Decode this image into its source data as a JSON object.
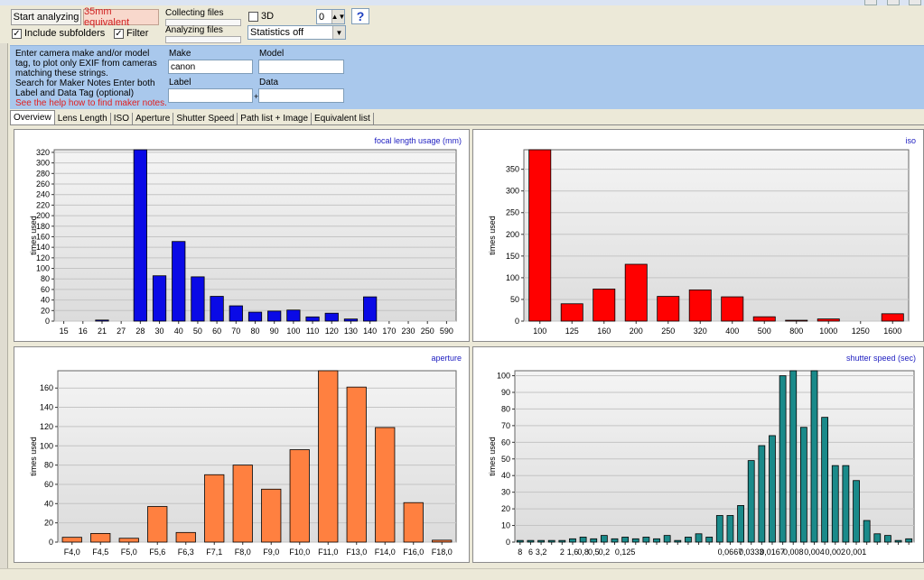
{
  "toolbar": {
    "start_label": "Start analyzing",
    "equiv_label": "35mm equivalent",
    "include_subfolders_label": "Include subfolders",
    "include_subfolders_checked": true,
    "filter_label": "Filter",
    "filter_checked": true,
    "collecting_label": "Collecting files",
    "analyzing_label": "Analyzing files",
    "threed_label": "3D",
    "threed_checked": false,
    "spinner_value": "0",
    "statistics_value": "Statistics off",
    "help_label": "?"
  },
  "filter_panel": {
    "make_instructions": "Enter camera make and/or model tag, to plot only EXIF from cameras matching these strings.",
    "makernote_instructions": "Search for Maker Notes Enter both Label and Data Tag (optional)",
    "help_link": "See the help how to find maker notes.",
    "make_label": "Make",
    "make_value": "canon",
    "model_label": "Model",
    "model_value": "",
    "label_label": "Label",
    "label_value": "",
    "data_label": "Data",
    "data_value": "",
    "plus": "+"
  },
  "tabs": [
    {
      "label": "Overview",
      "active": true
    },
    {
      "label": "Lens Length",
      "active": false
    },
    {
      "label": "ISO",
      "active": false
    },
    {
      "label": "Aperture",
      "active": false
    },
    {
      "label": "Shutter Speed",
      "active": false
    },
    {
      "label": "Path list + Image",
      "active": false
    },
    {
      "label": "Equivalent list",
      "active": false
    }
  ],
  "colors": {
    "focal": "#0a0ae6",
    "iso": "#ff0000",
    "aperture": "#ff8040",
    "shutter": "#1a8a8a",
    "title": "#1c1cc0"
  },
  "chart_data": [
    {
      "type": "bar",
      "title": "focal length usage (mm)",
      "ylabel": "times used",
      "ylim": [
        0,
        325
      ],
      "yticks": [
        0,
        20,
        40,
        60,
        80,
        100,
        120,
        140,
        160,
        180,
        200,
        220,
        240,
        260,
        280,
        300,
        320
      ],
      "categories": [
        "15",
        "16",
        "21",
        "27",
        "28",
        "30",
        "40",
        "50",
        "60",
        "70",
        "80",
        "90",
        "100",
        "110",
        "120",
        "130",
        "140",
        "170",
        "230",
        "250",
        "590"
      ],
      "values": [
        0,
        0,
        2,
        0,
        325,
        86,
        151,
        84,
        47,
        29,
        17,
        19,
        21,
        8,
        15,
        4,
        46,
        0,
        0,
        0,
        0
      ]
    },
    {
      "type": "bar",
      "title": "iso",
      "ylabel": "times used",
      "ylim": [
        0,
        395
      ],
      "yticks": [
        0,
        50,
        100,
        150,
        200,
        250,
        300,
        350
      ],
      "categories": [
        "100",
        "125",
        "160",
        "200",
        "250",
        "320",
        "400",
        "500",
        "800",
        "1000",
        "1250",
        "1600"
      ],
      "values": [
        395,
        40,
        74,
        131,
        57,
        72,
        56,
        10,
        2,
        5,
        0,
        17
      ]
    },
    {
      "type": "bar",
      "title": "aperture",
      "ylabel": "times used",
      "ylim": [
        0,
        178
      ],
      "yticks": [
        0,
        20,
        40,
        60,
        80,
        100,
        120,
        140,
        160
      ],
      "categories": [
        "F4,0",
        "F4,5",
        "F5,0",
        "F5,6",
        "F6,3",
        "F7,1",
        "F8,0",
        "F9,0",
        "F10,0",
        "F11,0",
        "F13,0",
        "F14,0",
        "F16,0",
        "F18,0"
      ],
      "values": [
        5,
        9,
        4,
        37,
        10,
        70,
        80,
        55,
        96,
        178,
        161,
        119,
        41,
        2
      ]
    },
    {
      "type": "bar",
      "title": "shutter speed (sec)",
      "ylabel": "times used",
      "ylim": [
        0,
        103
      ],
      "yticks": [
        0,
        10,
        20,
        30,
        40,
        50,
        60,
        70,
        80,
        90,
        100
      ],
      "tick_labels": [
        "8",
        "6",
        "3,2",
        "2",
        "1,6",
        "0,8",
        "0,5",
        "0,2",
        "0,125",
        "0,0667",
        "0,0333",
        "0,0167",
        "0,008",
        "0,004",
        "0,002",
        "0,001"
      ],
      "values": [
        1,
        1,
        1,
        1,
        1,
        2,
        3,
        2,
        4,
        2,
        3,
        2,
        3,
        2,
        4,
        1,
        3,
        5,
        3,
        16,
        16,
        22,
        49,
        58,
        64,
        100,
        103,
        69,
        103,
        75,
        46,
        46,
        37,
        13,
        5,
        4,
        1,
        2
      ]
    }
  ]
}
